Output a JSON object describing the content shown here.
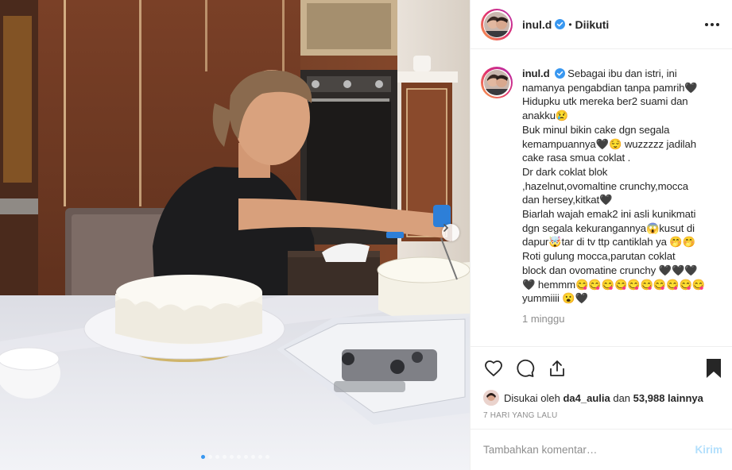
{
  "header": {
    "username": "inul.d",
    "separator": "•",
    "follow_state": "Diikuti"
  },
  "caption": {
    "username": "inul.d",
    "lines": [
      "Sebagai ibu dan istri, ini",
      "namanya pengabdian tanpa pamrih🖤",
      "Hidupku utk mereka ber2 suami dan",
      "anakku😢",
      "Buk minul bikin cake dgn segala",
      "kemampuannya🖤😌 wuzzzzz jadilah",
      "cake rasa smua coklat .",
      "Dr dark coklat blok",
      ",hazelnut,ovomaltine crunchy,mocca",
      "dan hersey,kitkat🖤",
      "Biarlah wajah emak2 ini asli kunikmati",
      "dgn segala kekurangannya😱kusut di",
      "dapur🤯tar di tv ttp cantiklah ya 🤭🤭",
      "Roti gulung mocca,parutan coklat",
      "block dan ovomatine crunchy 🖤🖤🖤",
      "🖤 hemmm😋😋😋😋😋😋😋😋😋😋",
      "yummiiii 😮🖤"
    ],
    "time_ago": "1 minggu"
  },
  "likes": {
    "prefix": "Disukai oleh",
    "liker": "da4_aulia",
    "conjunction": "dan",
    "count_text": "53,988 lainnya"
  },
  "date": "7 HARI YANG LALU",
  "comment_box": {
    "placeholder": "Tambahkan komentar…",
    "post_label": "Kirim"
  },
  "carousel": {
    "total_slides": 10,
    "active_slide": 1
  },
  "icons": {
    "verified": "verified-badge-icon",
    "more": "more-options-icon",
    "like": "heart-icon",
    "comment": "comment-bubble-icon",
    "share": "share-icon",
    "save": "bookmark-icon",
    "next": "chevron-right-icon"
  },
  "colors": {
    "verified_blue": "#3897f0",
    "text": "#262626",
    "muted": "#8e8e8e",
    "post_disabled": "#b2dffc",
    "active_dot": "#3897f0"
  }
}
